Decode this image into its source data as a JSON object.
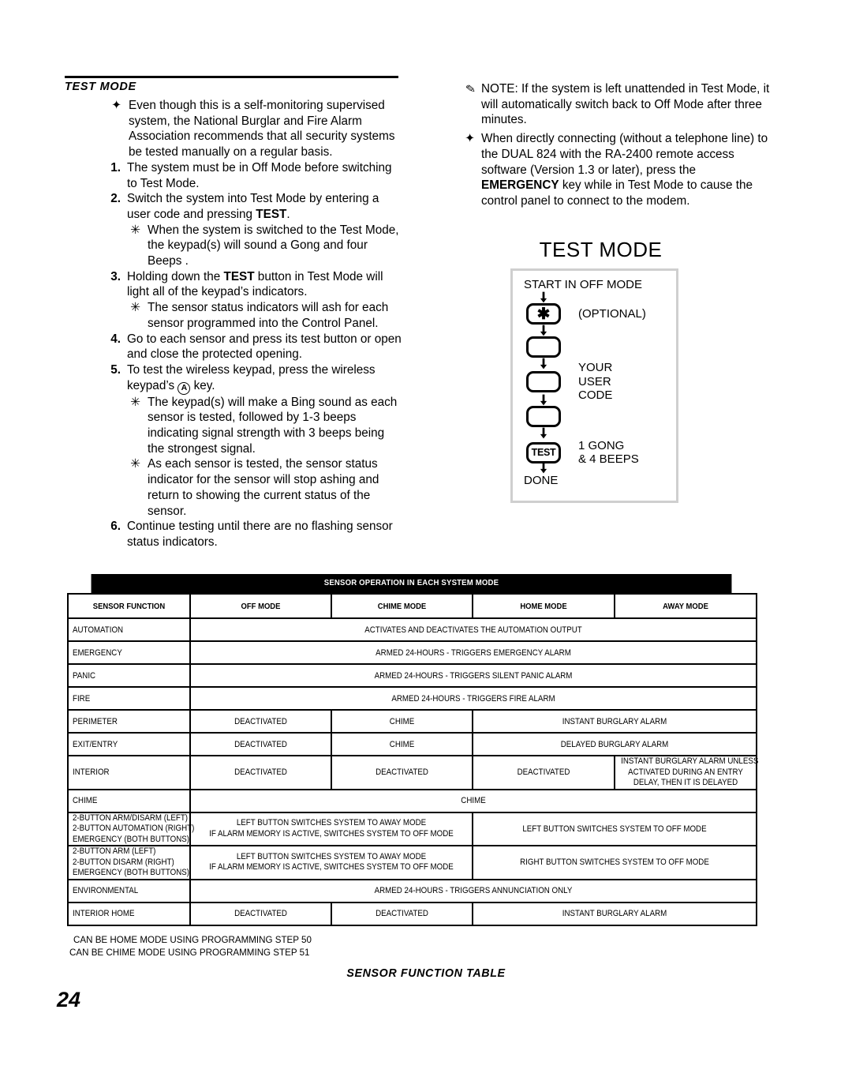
{
  "page": {
    "number": "24"
  },
  "left_column": {
    "section_title": "TEST MODE",
    "items": [
      {
        "marker": "✦",
        "level": "diamond",
        "text": "Even though this is a self-monitoring supervised system, the National Burglar and Fire Alarm Association recommends that all security systems be tested manually on a regular basis."
      },
      {
        "marker": "1.",
        "level": "number",
        "text": "The system must be in Off Mode before switching to Test Mode."
      },
      {
        "marker": "2.",
        "level": "number",
        "text": "Switch the system into Test Mode by entering a user code and pressing TEST."
      },
      {
        "marker": "✳",
        "level": "asterisk",
        "text": "When the system is switched to the Test Mode, the keypad(s) will sound a  Gong  and four  Beeps ."
      },
      {
        "marker": "3.",
        "level": "number",
        "text": "Holding down the TEST button in Test Mode will light all of the keypad’s indicators."
      },
      {
        "marker": "✳",
        "level": "asterisk",
        "text": "The sensor status indicators will  ash for each sensor programmed into the Control Panel."
      },
      {
        "marker": "4.",
        "level": "number",
        "text": "Go to each sensor and press its test button or open and close the protected opening."
      },
      {
        "marker": "5.",
        "level": "number",
        "text": "To test the wireless keypad, press the wireless keypad’s A key."
      },
      {
        "marker": "✳",
        "level": "asterisk",
        "text": "The keypad(s) will make a  Bing  sound as each sensor is tested, followed by 1-3 beeps indicating signal strength with 3 beeps being the strongest signal."
      },
      {
        "marker": "✳",
        "level": "asterisk",
        "text": "As each sensor is tested, the sensor status indicator for the sensor will stop  ashing and return to showing the current status of the sensor."
      },
      {
        "marker": "6.",
        "level": "number",
        "text": "Continue testing until there are no flashing sensor status indicators."
      }
    ]
  },
  "right_column": {
    "items": [
      {
        "marker": "pencil-icon",
        "level": "note",
        "text": "NOTE: If the system is left unattended in Test Mode, it will automatically switch back to Off Mode after three minutes."
      },
      {
        "marker": "✦",
        "level": "diamond",
        "text": "When directly connecting (without a telephone line) to the DUAL 824 with the RA-2400 remote access software (Version 1.3 or later), press the EMERGENCY key while in Test Mode to cause the control panel to connect to the modem."
      }
    ]
  },
  "diagram": {
    "title": "TEST MODE",
    "start_label": "START IN OFF MODE",
    "end_label": "DONE",
    "steps": [
      {
        "key": "✱",
        "key_type": "star",
        "side_text": "(OPTIONAL)"
      },
      {
        "key": "",
        "key_type": "blank",
        "side_text": ""
      },
      {
        "key": "",
        "key_type": "blank",
        "side_text": "YOUR\nUSER\nCODE"
      },
      {
        "key": "",
        "key_type": "blank",
        "side_text": ""
      },
      {
        "key": "TEST",
        "key_type": "test",
        "side_text": "1 GONG\n& 4 BEEPS"
      }
    ],
    "side_texts": {
      "optional": "(OPTIONAL)",
      "your": "YOUR",
      "user": "USER",
      "code": "CODE",
      "gong": "1 GONG",
      "beeps": "& 4 BEEPS"
    }
  },
  "table": {
    "banner": "SENSOR OPERATION IN EACH SYSTEM MODE",
    "caption": "SENSOR FUNCTION TABLE",
    "headers": [
      "SENSOR FUNCTION",
      "OFF MODE",
      "CHIME MODE",
      "HOME MODE",
      "AWAY MODE"
    ],
    "rows": [
      {
        "function": "AUTOMATION",
        "cells": [
          {
            "text": "ACTIVATES AND DEACTIVATES THE AUTOMATION OUTPUT",
            "span": 4
          }
        ]
      },
      {
        "function": "EMERGENCY",
        "cells": [
          {
            "text": "ARMED 24-HOURS - TRIGGERS EMERGENCY ALARM",
            "span": 4
          }
        ]
      },
      {
        "function": "PANIC",
        "cells": [
          {
            "text": "ARMED 24-HOURS - TRIGGERS SILENT PANIC ALARM",
            "span": 4
          }
        ]
      },
      {
        "function": "FIRE",
        "cells": [
          {
            "text": "ARMED 24-HOURS - TRIGGERS FIRE ALARM",
            "span": 4
          }
        ]
      },
      {
        "function": "PERIMETER",
        "cells": [
          {
            "text": "DEACTIVATED",
            "span": 1
          },
          {
            "text": "CHIME",
            "span": 1
          },
          {
            "text": "INSTANT BURGLARY ALARM",
            "span": 2
          }
        ]
      },
      {
        "function": "EXIT/ENTRY",
        "cells": [
          {
            "text": "DEACTIVATED",
            "span": 1
          },
          {
            "text": "CHIME",
            "span": 1
          },
          {
            "text": "DELAYED BURGLARY ALARM",
            "span": 2
          }
        ]
      },
      {
        "function": "INTERIOR",
        "cells": [
          {
            "text": "DEACTIVATED",
            "span": 1
          },
          {
            "text": "DEACTIVATED",
            "span": 1
          },
          {
            "text": "DEACTIVATED",
            "span": 1
          },
          {
            "text": "INSTANT BURGLARY ALARM UNLESS ACTIVATED DURING AN ENTRY DELAY, THEN IT IS DELAYED",
            "span": 1
          }
        ]
      },
      {
        "function": "CHIME",
        "cells": [
          {
            "text": "CHIME",
            "span": 4
          }
        ]
      },
      {
        "function": "2-BUTTON ARM/DISARM (LEFT)\n2-BUTTON AUTOMATION (RIGHT)\nEMERGENCY (BOTH BUTTONS)",
        "cells": [
          {
            "text": "LEFT BUTTON SWITCHES SYSTEM TO AWAY MODE\nIF ALARM MEMORY IS ACTIVE, SWITCHES SYSTEM TO OFF MODE",
            "span": 2
          },
          {
            "text": "LEFT BUTTON SWITCHES SYSTEM TO OFF MODE",
            "span": 2
          }
        ]
      },
      {
        "function": "2-BUTTON ARM (LEFT)\n2-BUTTON DISARM (RIGHT)\nEMERGENCY (BOTH BUTTONS)",
        "cells": [
          {
            "text": "LEFT BUTTON SWITCHES SYSTEM TO AWAY MODE\nIF ALARM MEMORY IS ACTIVE, SWITCHES SYSTEM TO OFF MODE",
            "span": 2
          },
          {
            "text": "RIGHT BUTTON SWITCHES SYSTEM TO OFF MODE",
            "span": 2
          }
        ]
      },
      {
        "function": "ENVIRONMENTAL",
        "cells": [
          {
            "text": "ARMED 24-HOURS - TRIGGERS ANNUNCIATION ONLY",
            "span": 4
          }
        ]
      },
      {
        "function": "INTERIOR HOME",
        "cells": [
          {
            "text": "DEACTIVATED",
            "span": 1
          },
          {
            "text": "DEACTIVATED",
            "span": 1
          },
          {
            "text": "INSTANT BURGLARY ALARM",
            "span": 2
          }
        ]
      }
    ],
    "notes": [
      "CAN BE HOME MODE USING PROGRAMMING STEP 50",
      "CAN BE CHIME MODE USING PROGRAMMING STEP 51"
    ]
  }
}
